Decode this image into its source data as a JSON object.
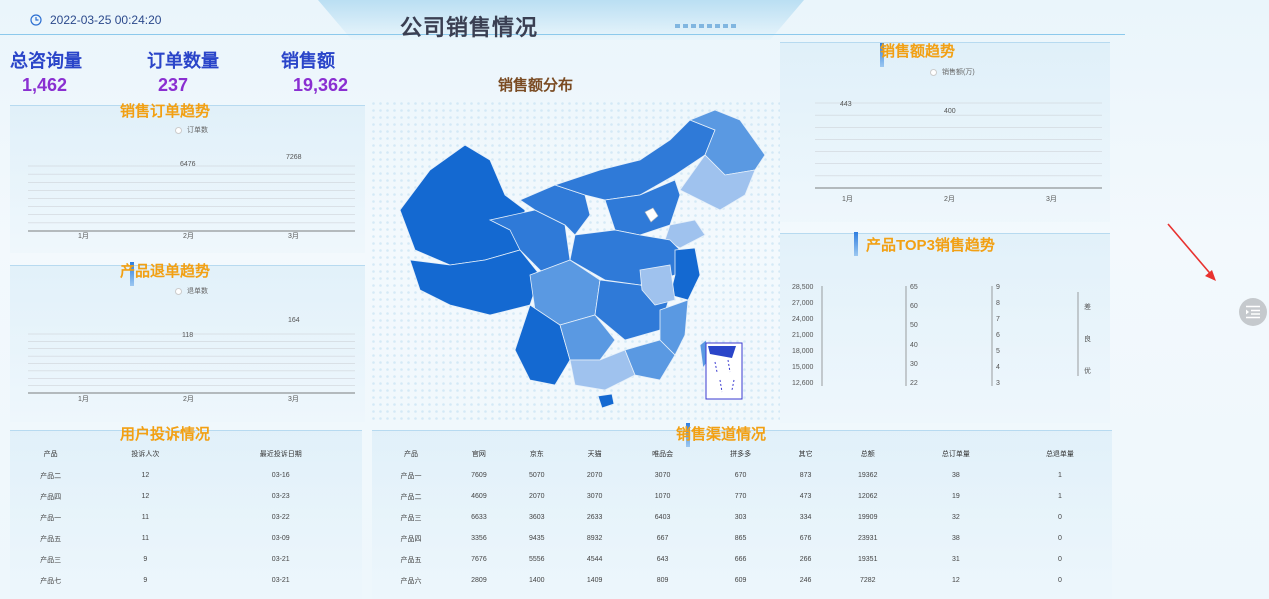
{
  "header": {
    "datetime": "2022-03-25 00:24:20",
    "title": "公司销售情况"
  },
  "kpis": [
    {
      "label": "总咨询量",
      "value": "1,462"
    },
    {
      "label": "订单数量",
      "value": "237"
    },
    {
      "label": "销售额",
      "value": "19,362"
    }
  ],
  "map": {
    "title": "销售额分布",
    "colors": {
      "dark": "#1469d1",
      "mid": "#2f7ad8",
      "light": "#5a99e2",
      "pale": "#9fc2ee"
    }
  },
  "order_trend": {
    "title": "销售订单趋势",
    "chart_data": {
      "type": "line",
      "categories": [
        "1月",
        "2月",
        "3月"
      ],
      "series": [
        {
          "name": "订单数",
          "values": [
            null,
            6476,
            7268
          ]
        }
      ],
      "data_labels": [
        "6476",
        "7268"
      ]
    }
  },
  "return_trend": {
    "title": "产品退单趋势",
    "chart_data": {
      "type": "line",
      "categories": [
        "1月",
        "2月",
        "3月"
      ],
      "series": [
        {
          "name": "退单数",
          "values": [
            null,
            118,
            164
          ]
        }
      ],
      "data_labels": [
        "118",
        "164"
      ]
    }
  },
  "sales_trend": {
    "title": "销售额趋势",
    "chart_data": {
      "type": "line",
      "categories": [
        "1月",
        "2月",
        "3月"
      ],
      "series": [
        {
          "name": "销售额(万)",
          "values": [
            443,
            400,
            null
          ]
        }
      ],
      "data_labels": [
        "443",
        "400"
      ]
    }
  },
  "top3": {
    "title": "产品TOP3销售趋势",
    "chart_data": {
      "type": "line",
      "axis1_ticks": [
        "28,500",
        "27,000",
        "24,000",
        "21,000",
        "18,000",
        "15,000",
        "12,600"
      ],
      "axis2_ticks": [
        "65",
        "60",
        "50",
        "40",
        "30",
        "22"
      ],
      "axis3_ticks": [
        "9",
        "8",
        "7",
        "6",
        "5",
        "4",
        "3"
      ],
      "side_labels": [
        "差",
        "良",
        "优"
      ]
    }
  },
  "complaints": {
    "title": "用户投诉情况",
    "columns": [
      "产品",
      "投诉人次",
      "最近投诉日期"
    ],
    "rows": [
      [
        "产品二",
        "12",
        "03-16"
      ],
      [
        "产品四",
        "12",
        "03-23"
      ],
      [
        "产品一",
        "11",
        "03-22"
      ],
      [
        "产品五",
        "11",
        "03-09"
      ],
      [
        "产品三",
        "9",
        "03-21"
      ],
      [
        "产品七",
        "9",
        "03-21"
      ]
    ]
  },
  "channels": {
    "title": "销售渠道情况",
    "columns": [
      "产品",
      "官网",
      "京东",
      "天猫",
      "唯品会",
      "拼多多",
      "其它",
      "总额",
      "总订单量",
      "总退单量"
    ],
    "rows": [
      [
        "产品一",
        "7609",
        "5070",
        "2070",
        "3070",
        "670",
        "873",
        "19362",
        "38",
        "1"
      ],
      [
        "产品二",
        "4609",
        "2070",
        "3070",
        "1070",
        "770",
        "473",
        "12062",
        "19",
        "1"
      ],
      [
        "产品三",
        "6633",
        "3603",
        "2633",
        "6403",
        "303",
        "334",
        "19909",
        "32",
        "0"
      ],
      [
        "产品四",
        "3356",
        "9435",
        "8932",
        "667",
        "865",
        "676",
        "23931",
        "38",
        "0"
      ],
      [
        "产品五",
        "7676",
        "5556",
        "4544",
        "643",
        "666",
        "266",
        "19351",
        "31",
        "0"
      ],
      [
        "产品六",
        "2809",
        "1400",
        "1409",
        "809",
        "609",
        "246",
        "7282",
        "12",
        "0"
      ]
    ]
  },
  "colors": {
    "kpi_label": "#2a45c9",
    "kpi_value": "#8a2fd1",
    "panel_title": "#f2a013",
    "map_title": "#7a4b23"
  },
  "icons": {
    "clock": "clock-icon",
    "side_menu": "menu-indent-icon",
    "annotation": "red-arrow"
  }
}
